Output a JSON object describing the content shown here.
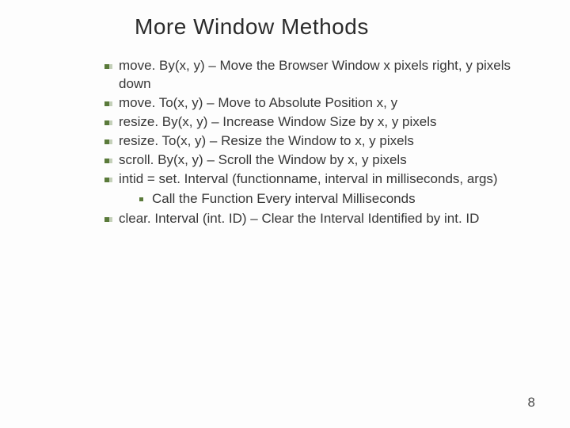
{
  "title": "More Window Methods",
  "bullets": {
    "b0": "move. By(x, y) –  Move the Browser Window x pixels right, y pixels down",
    "b1": "move. To(x, y) – Move to Absolute Position x, y",
    "b2": "resize. By(x, y) – Increase Window Size by x, y pixels",
    "b3": "resize. To(x, y) – Resize the Window to x, y pixels",
    "b4": "scroll. By(x, y) –  Scroll the Window by x, y pixels",
    "b5": "intid = set. Interval (functionname, interval in milliseconds, args)",
    "b5_sub": "Call the Function Every interval Milliseconds",
    "b6": "clear. Interval (int. ID) – Clear the Interval Identified by int. ID"
  },
  "page_number": "8"
}
